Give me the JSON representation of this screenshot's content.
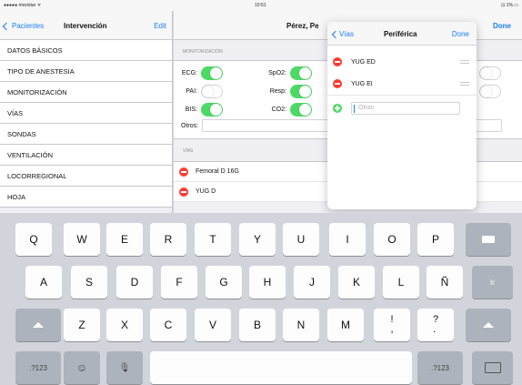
{
  "status": {
    "carrier": "●●●●● movistar ᯤ",
    "time": "10:51",
    "battery": "⊡ 1% ▭"
  },
  "master": {
    "back_label": "Pacientes",
    "title": "Intervención",
    "edit_label": "Edit",
    "items": [
      {
        "label": "DATOS BÁSICOS"
      },
      {
        "label": "TIPO DE ANESTESIA"
      },
      {
        "label": "MONITORIZACIÓN"
      },
      {
        "label": "VÍAS"
      },
      {
        "label": "SONDAS"
      },
      {
        "label": "VENTILACIÓN"
      },
      {
        "label": "LOCORREGIONAL"
      },
      {
        "label": "HOJA"
      }
    ]
  },
  "detail": {
    "title": "Pérez, Pe",
    "done_label": "Done",
    "monitor_header": "MONITORIZACIÓN",
    "switches": {
      "ecg": {
        "label": "ECG:",
        "on": true
      },
      "pai": {
        "label": "PAI:",
        "on": false
      },
      "bis": {
        "label": "BIS:",
        "on": true
      },
      "spo2": {
        "label": "SpO2:",
        "on": true
      },
      "resp": {
        "label": "Resp:",
        "on": true
      },
      "co2": {
        "label": "CO2:",
        "on": true
      }
    },
    "otros_label": "Otros:",
    "vias_header": "VÍAS",
    "vias": [
      {
        "label": "Femoral D 16G"
      },
      {
        "label": "YUG D"
      }
    ]
  },
  "popover": {
    "back_label": "Vías",
    "title": "Periférica",
    "done_label": "Done",
    "items": [
      {
        "label": "YUG ED"
      },
      {
        "label": "YUG EI"
      }
    ],
    "input_placeholder": "Otras"
  },
  "keyboard": {
    "row1": [
      "Q",
      "W",
      "E",
      "R",
      "T",
      "Y",
      "U",
      "I",
      "O",
      "P"
    ],
    "row2": [
      "A",
      "S",
      "D",
      "F",
      "G",
      "H",
      "J",
      "K",
      "L",
      "Ñ"
    ],
    "row3": [
      "Z",
      "X",
      "C",
      "V",
      "B",
      "N",
      "M",
      "!\n,",
      "?\n."
    ],
    "num_label": ".?123",
    "emoji": "☺",
    "mic": "🎙",
    "return_label": "Ir"
  }
}
